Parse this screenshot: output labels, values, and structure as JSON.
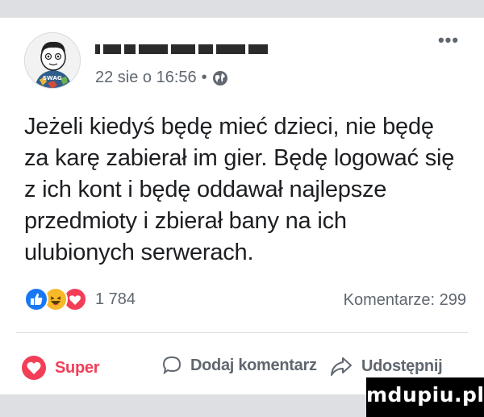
{
  "post": {
    "author": {
      "avatar": "cartoon-boy-avatar",
      "avatar_text": "SWAG"
    },
    "more_label": "•••",
    "meta": {
      "time": "22 sie o 16:56",
      "separator": "•",
      "privacy_icon": "globe-icon"
    },
    "text_lines": [
      "Jeżeli kiedyś będę mieć dzieci, nie będę",
      "za karę zabierał im gier. Będę logować się",
      "z ich kont i będę oddawał najlepsze",
      "przedmioty i zbierał bany na ich",
      "ulubionych serwerach."
    ],
    "reactions": {
      "icons": [
        "like-icon",
        "haha-icon",
        "love-icon"
      ],
      "count": "1 784"
    },
    "comments": {
      "label": "Komentarze: 299"
    }
  },
  "actions": {
    "super": "Super",
    "comment": "Dodaj komentarz",
    "share": "Udostępnij"
  },
  "watermark": {
    "text": "mdupiu.pl"
  },
  "colors": {
    "like_blue": "#1877f2",
    "haha_yellow": "#f7b928",
    "love_red": "#f33e58",
    "meta_gray": "#606770",
    "text": "#1c1e21"
  }
}
